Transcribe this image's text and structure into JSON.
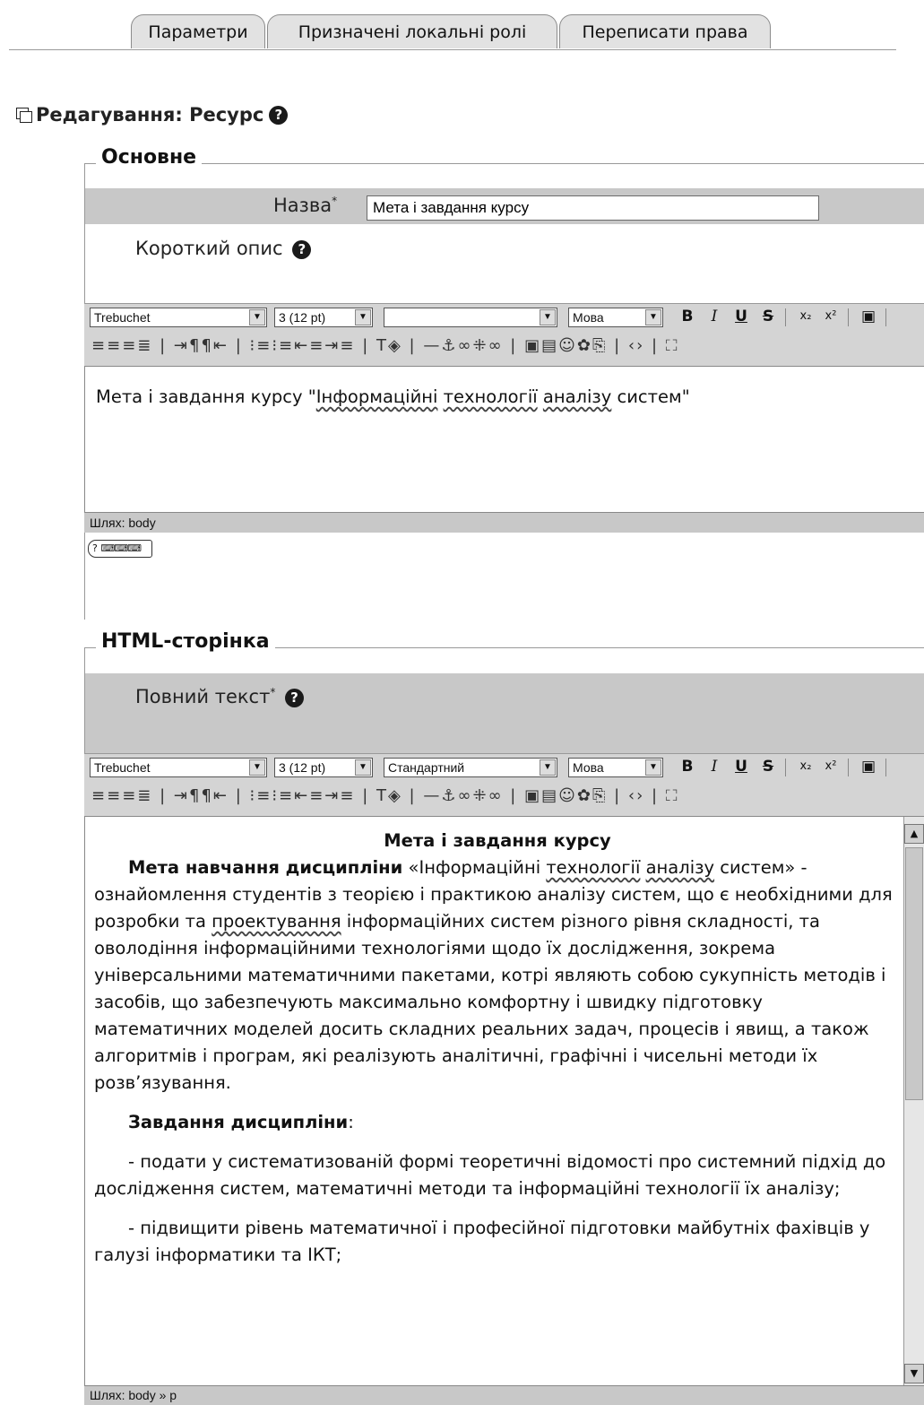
{
  "tabs": [
    "Параметри",
    "Призначені локальні ролі",
    "Переписати права"
  ],
  "page_title": "Редагування: Ресурс",
  "section_general": {
    "legend": "Основне",
    "name_label": "Назва",
    "required_mark": "*",
    "name_value": "Мета і завдання курсу",
    "summary_label": "Короткий опис"
  },
  "toolbar1": {
    "font": "Trebuchet",
    "size": "3 (12 pt)",
    "style": "",
    "lang": "Мова",
    "bold": "B",
    "italic": "I",
    "underline": "U",
    "strike": "S",
    "sub": "x₂",
    "sup": "x²"
  },
  "summary_editor": {
    "text_before": "Мета і завдання курсу \"",
    "w1": "Інформаційні",
    "w2": "технології",
    "w3": "аналізу",
    "text_after": " систем\"",
    "path": "Шлях:  body",
    "kbd_help": "?"
  },
  "section_html": {
    "legend": "HTML-сторінка",
    "fulltext_label": "Повний текст",
    "required_mark": "*"
  },
  "toolbar2": {
    "font": "Trebuchet",
    "size": "3 (12 pt)",
    "style": "Стандартний",
    "lang": "Мова",
    "bold": "B",
    "italic": "I",
    "underline": "U",
    "strike": "S",
    "sub": "x₂",
    "sup": "x²"
  },
  "full_editor": {
    "heading": "Мета і завдання курсу",
    "p1_bold": "Мета навчання дисципліни",
    "p1_a": " «Інформаційні ",
    "p1_w1": "технології",
    "p1_w2": "аналізу",
    "p1_b": " систем» - ознайомлення студентів з теорією і практикою аналізу систем, що є необхідними для розробки та ",
    "p1_w3": "проектування",
    "p1_c": " інформаційних систем різного рівня складності, та оволодіння інформаційними технологіями щодо їх дослідження, зокрема універсальними математичними пакетами, котрі являють собою сукупність методів і засобів, що забезпечують максимально комфортну і швидку підготовку математичних моделей досить складних реальних задач, процесів і явищ, а також алгоритмів і програм, які реалізують аналітичні, графічні і чисельні методи їх розв’язування.",
    "p2_bold": "Завдання дисципліни",
    "p2_colon": ":",
    "p3": "- подати у систематизованій формі теоретичні відомості про системний підхід до дослідження систем, математичні методи та інформаційні технології їх аналізу;",
    "p4": "- підвищити рівень математичної і професійної підготовки майбутніх фахівців у галузі інформатики та ІКТ;",
    "path": "Шлях:  body » p"
  }
}
